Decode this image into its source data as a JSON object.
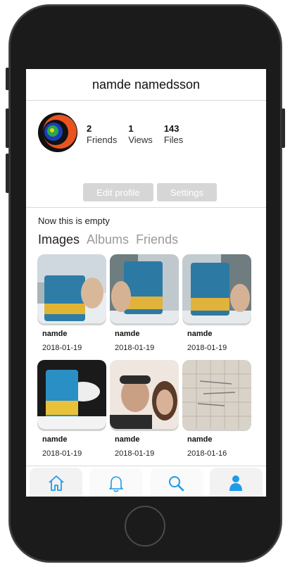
{
  "header": {
    "title": "namde namedsson"
  },
  "profile": {
    "stats": [
      {
        "value": "2",
        "label": "Friends"
      },
      {
        "value": "1",
        "label": "Views"
      },
      {
        "value": "143",
        "label": "Files"
      }
    ],
    "edit_label": "Edit profile",
    "settings_label": "Settings",
    "bio": "Now this is empty"
  },
  "tabs": [
    {
      "label": "Images",
      "active": true
    },
    {
      "label": "Albums",
      "active": false
    },
    {
      "label": "Friends",
      "active": false
    }
  ],
  "images": [
    {
      "name": "namde",
      "date": "2018-01-19"
    },
    {
      "name": "namde",
      "date": "2018-01-19"
    },
    {
      "name": "namde",
      "date": "2018-01-19"
    },
    {
      "name": "namde",
      "date": "2018-01-19"
    },
    {
      "name": "namde",
      "date": "2018-01-19"
    },
    {
      "name": "namde",
      "date": "2018-01-16"
    }
  ],
  "tabbar": {
    "items": [
      "home-icon",
      "bell-icon",
      "search-icon",
      "user-icon"
    ],
    "accent": "#1e9be8"
  }
}
